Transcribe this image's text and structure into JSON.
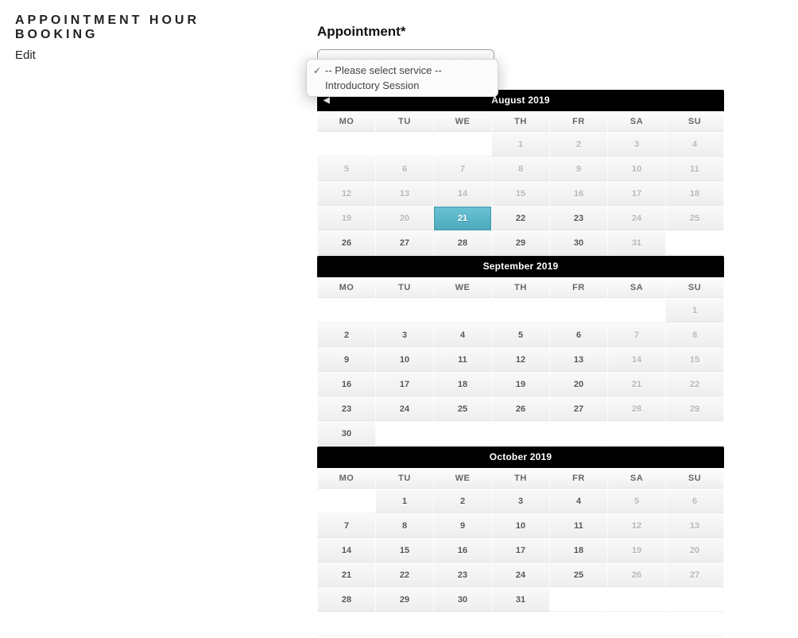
{
  "sidebar": {
    "title": "APPOINTMENT HOUR BOOKING",
    "edit": "Edit"
  },
  "form": {
    "appointment_label": "Appointment*",
    "select": {
      "options": [
        {
          "label": "-- Please select service --",
          "checked": true
        },
        {
          "label": "Introductory Session",
          "checked": false
        }
      ]
    },
    "nav": {
      "prev_symbol": "◀"
    },
    "dow": {
      "mo": "MO",
      "tu": "TU",
      "we": "WE",
      "th": "TH",
      "fr": "FR",
      "sa": "SA",
      "su": "SU"
    },
    "calendars": [
      {
        "title": "August 2019",
        "show_prev": true,
        "weeks": [
          [
            {
              "d": "",
              "t": "empty"
            },
            {
              "d": "",
              "t": "empty"
            },
            {
              "d": "",
              "t": "empty"
            },
            {
              "d": "1",
              "t": "disabled"
            },
            {
              "d": "2",
              "t": "disabled"
            },
            {
              "d": "3",
              "t": "disabled"
            },
            {
              "d": "4",
              "t": "disabled"
            }
          ],
          [
            {
              "d": "5",
              "t": "disabled"
            },
            {
              "d": "6",
              "t": "disabled"
            },
            {
              "d": "7",
              "t": "disabled"
            },
            {
              "d": "8",
              "t": "disabled"
            },
            {
              "d": "9",
              "t": "disabled"
            },
            {
              "d": "10",
              "t": "disabled"
            },
            {
              "d": "11",
              "t": "disabled"
            }
          ],
          [
            {
              "d": "12",
              "t": "disabled"
            },
            {
              "d": "13",
              "t": "disabled"
            },
            {
              "d": "14",
              "t": "disabled"
            },
            {
              "d": "15",
              "t": "disabled"
            },
            {
              "d": "16",
              "t": "disabled"
            },
            {
              "d": "17",
              "t": "disabled"
            },
            {
              "d": "18",
              "t": "disabled"
            }
          ],
          [
            {
              "d": "19",
              "t": "disabled"
            },
            {
              "d": "20",
              "t": "disabled"
            },
            {
              "d": "21",
              "t": "selected"
            },
            {
              "d": "22",
              "t": "available"
            },
            {
              "d": "23",
              "t": "available"
            },
            {
              "d": "24",
              "t": "disabled"
            },
            {
              "d": "25",
              "t": "disabled"
            }
          ],
          [
            {
              "d": "26",
              "t": "available"
            },
            {
              "d": "27",
              "t": "available"
            },
            {
              "d": "28",
              "t": "available"
            },
            {
              "d": "29",
              "t": "available"
            },
            {
              "d": "30",
              "t": "available"
            },
            {
              "d": "31",
              "t": "disabled"
            },
            {
              "d": "",
              "t": "empty"
            }
          ]
        ]
      },
      {
        "title": "September 2019",
        "show_prev": false,
        "weeks": [
          [
            {
              "d": "",
              "t": "empty"
            },
            {
              "d": "",
              "t": "empty"
            },
            {
              "d": "",
              "t": "empty"
            },
            {
              "d": "",
              "t": "empty"
            },
            {
              "d": "",
              "t": "empty"
            },
            {
              "d": "",
              "t": "empty"
            },
            {
              "d": "1",
              "t": "disabled"
            }
          ],
          [
            {
              "d": "2",
              "t": "available"
            },
            {
              "d": "3",
              "t": "available"
            },
            {
              "d": "4",
              "t": "available"
            },
            {
              "d": "5",
              "t": "available"
            },
            {
              "d": "6",
              "t": "available"
            },
            {
              "d": "7",
              "t": "disabled"
            },
            {
              "d": "8",
              "t": "disabled"
            }
          ],
          [
            {
              "d": "9",
              "t": "available"
            },
            {
              "d": "10",
              "t": "available"
            },
            {
              "d": "11",
              "t": "available"
            },
            {
              "d": "12",
              "t": "available"
            },
            {
              "d": "13",
              "t": "available"
            },
            {
              "d": "14",
              "t": "disabled"
            },
            {
              "d": "15",
              "t": "disabled"
            }
          ],
          [
            {
              "d": "16",
              "t": "available"
            },
            {
              "d": "17",
              "t": "available"
            },
            {
              "d": "18",
              "t": "available"
            },
            {
              "d": "19",
              "t": "available"
            },
            {
              "d": "20",
              "t": "available"
            },
            {
              "d": "21",
              "t": "disabled"
            },
            {
              "d": "22",
              "t": "disabled"
            }
          ],
          [
            {
              "d": "23",
              "t": "available"
            },
            {
              "d": "24",
              "t": "available"
            },
            {
              "d": "25",
              "t": "available"
            },
            {
              "d": "26",
              "t": "available"
            },
            {
              "d": "27",
              "t": "available"
            },
            {
              "d": "28",
              "t": "disabled"
            },
            {
              "d": "29",
              "t": "disabled"
            }
          ],
          [
            {
              "d": "30",
              "t": "available"
            },
            {
              "d": "",
              "t": "empty"
            },
            {
              "d": "",
              "t": "empty"
            },
            {
              "d": "",
              "t": "empty"
            },
            {
              "d": "",
              "t": "empty"
            },
            {
              "d": "",
              "t": "empty"
            },
            {
              "d": "",
              "t": "empty"
            }
          ]
        ]
      },
      {
        "title": "October 2019",
        "show_prev": false,
        "weeks": [
          [
            {
              "d": "",
              "t": "empty"
            },
            {
              "d": "1",
              "t": "available"
            },
            {
              "d": "2",
              "t": "available"
            },
            {
              "d": "3",
              "t": "available"
            },
            {
              "d": "4",
              "t": "available"
            },
            {
              "d": "5",
              "t": "disabled"
            },
            {
              "d": "6",
              "t": "disabled"
            }
          ],
          [
            {
              "d": "7",
              "t": "available"
            },
            {
              "d": "8",
              "t": "available"
            },
            {
              "d": "9",
              "t": "available"
            },
            {
              "d": "10",
              "t": "available"
            },
            {
              "d": "11",
              "t": "available"
            },
            {
              "d": "12",
              "t": "disabled"
            },
            {
              "d": "13",
              "t": "disabled"
            }
          ],
          [
            {
              "d": "14",
              "t": "available"
            },
            {
              "d": "15",
              "t": "available"
            },
            {
              "d": "16",
              "t": "available"
            },
            {
              "d": "17",
              "t": "available"
            },
            {
              "d": "18",
              "t": "available"
            },
            {
              "d": "19",
              "t": "disabled"
            },
            {
              "d": "20",
              "t": "disabled"
            }
          ],
          [
            {
              "d": "21",
              "t": "available"
            },
            {
              "d": "22",
              "t": "available"
            },
            {
              "d": "23",
              "t": "available"
            },
            {
              "d": "24",
              "t": "available"
            },
            {
              "d": "25",
              "t": "available"
            },
            {
              "d": "26",
              "t": "disabled"
            },
            {
              "d": "27",
              "t": "disabled"
            }
          ],
          [
            {
              "d": "28",
              "t": "available"
            },
            {
              "d": "29",
              "t": "available"
            },
            {
              "d": "30",
              "t": "available"
            },
            {
              "d": "31",
              "t": "available"
            },
            {
              "d": "",
              "t": "empty"
            },
            {
              "d": "",
              "t": "empty"
            },
            {
              "d": "",
              "t": "empty"
            }
          ],
          [
            {
              "d": "",
              "t": "empty"
            },
            {
              "d": "",
              "t": "empty"
            },
            {
              "d": "",
              "t": "empty"
            },
            {
              "d": "",
              "t": "empty"
            },
            {
              "d": "",
              "t": "empty"
            },
            {
              "d": "",
              "t": "empty"
            },
            {
              "d": "",
              "t": "empty"
            }
          ]
        ]
      }
    ]
  }
}
